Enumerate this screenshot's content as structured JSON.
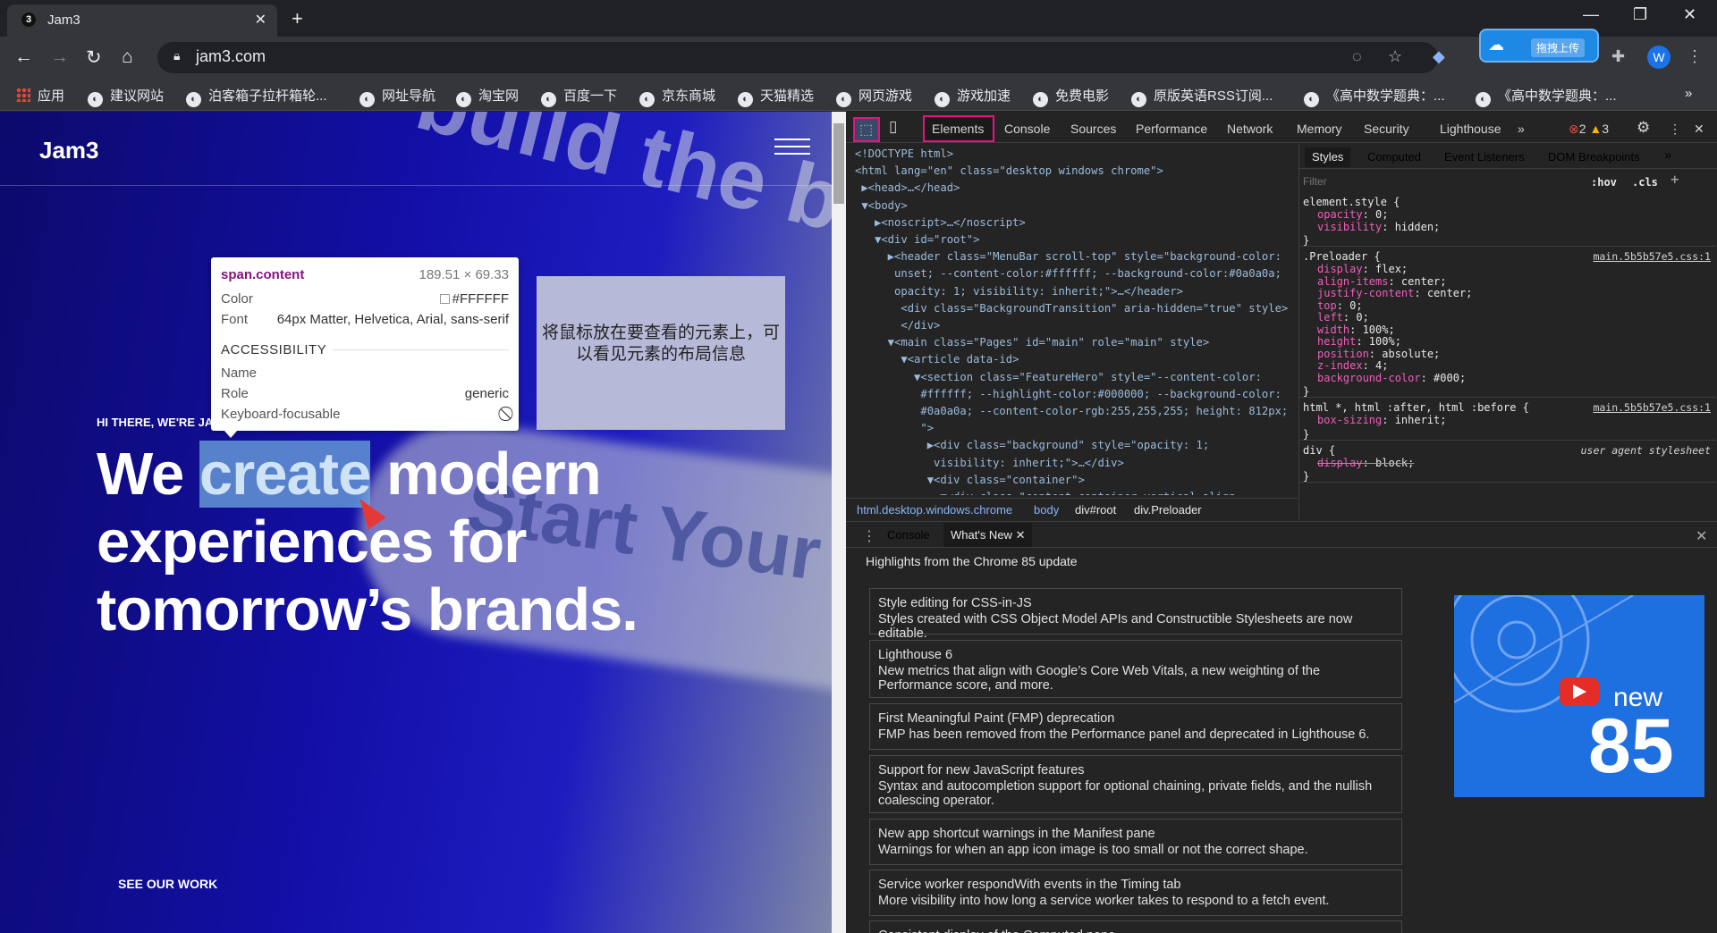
{
  "browser": {
    "tab_title": "Jam3",
    "tab_favicon": "3",
    "new_tab": "+",
    "url": "jam3.com",
    "upload_label": "拖拽上传",
    "avatar": "W",
    "window_controls": [
      "—",
      "❐",
      "✕"
    ],
    "bookmarks": [
      "应用",
      "建议网站",
      "泊客箱子拉杆箱轮...",
      "网址导航",
      "淘宝网",
      "百度一下",
      "京东商城",
      "天猫精选",
      "网页游戏",
      "游戏加速",
      "免费电影",
      "原版英语RSS订阅...",
      "《高中数学题典：...",
      "《高中数学题典：..."
    ],
    "bookmarks_more": "»"
  },
  "page": {
    "logo": "Jam3",
    "eyebrow": "HI THERE, WE'RE JA",
    "headline_pre": "We ",
    "headline_hl": "create",
    "headline_post": " modern experiences for tomorrow’s brands.",
    "see_work": "SEE OUR WORK",
    "bg_word_1": "build the bra",
    "bg_word_2": "Start Your Tra"
  },
  "tooltip": {
    "element": "span.content",
    "size": "189.51 × 69.33",
    "color_label": "Color",
    "color_value": "#FFFFFF",
    "font_label": "Font",
    "font_value": "64px Matter, Helvetica, Arial, sans-serif",
    "section": "ACCESSIBILITY",
    "name_label": "Name",
    "role_label": "Role",
    "role_value": "generic",
    "kb_label": "Keyboard-focusable"
  },
  "note": "将鼠标放在要查看的元素上，可以看见元素的布局信息",
  "devtools": {
    "tabs": [
      "Elements",
      "Console",
      "Sources",
      "Performance",
      "Network",
      "Memory",
      "Security",
      "Lighthouse"
    ],
    "more": "»",
    "errors": "2",
    "warnings": "3",
    "code": [
      "<!DOCTYPE html>",
      "<html lang=\"en\" class=\"desktop windows chrome\">",
      " ▶<head>…</head>",
      " ▼<body>",
      "   ▶<noscript>…</noscript>",
      "   ▼<div id=\"root\">",
      "     ▶<header class=\"MenuBar scroll-top\" style=\"background-color:",
      "      unset; --content-color:#ffffff; --background-color:#0a0a0a;",
      "      opacity: 1; visibility: inherit;\">…</header>",
      "       <div class=\"BackgroundTransition\" aria-hidden=\"true\" style>",
      "       </div>",
      "     ▼<main class=\"Pages\" id=\"main\" role=\"main\" style>",
      "       ▼<article data-id>",
      "         ▼<section class=\"FeatureHero\" style=\"--content-color:",
      "          #ffffff; --highlight-color:#000000; --background-color:",
      "          #0a0a0a; --content-color-rgb:255,255,255; height: 812px;",
      "          \">",
      "           ▶<div class=\"background\" style=\"opacity: 1;",
      "            visibility: inherit;\">…</div>",
      "           ▼<div class=\"container\">",
      "             ▼<div class=\"content-container vertical-align-"
    ],
    "breadcrumbs": [
      "html.desktop.windows.chrome",
      "body",
      "div#root",
      "div.Preloader"
    ],
    "styles_tabs": [
      "Styles",
      "Computed",
      "Event Listeners",
      "DOM Breakpoints"
    ],
    "filter_placeholder": "Filter",
    "hov": ":hov",
    "cls": ".cls",
    "styles": [
      {
        "sel": "element.style {",
        "src": "",
        "props": [
          [
            "opacity",
            "0"
          ],
          [
            "visibility",
            "hidden"
          ]
        ]
      },
      {
        "sel": ".Preloader {",
        "src": "main.5b5b57e5.css:1",
        "props": [
          [
            "display",
            "flex"
          ],
          [
            "align-items",
            "center"
          ],
          [
            "justify-content",
            "center"
          ],
          [
            "top",
            "0"
          ],
          [
            "left",
            "0"
          ],
          [
            "width",
            "100%"
          ],
          [
            "height",
            "100%"
          ],
          [
            "position",
            "absolute"
          ],
          [
            "z-index",
            "4"
          ],
          [
            "background-color",
            "#000"
          ]
        ]
      },
      {
        "sel": "html *, html :after, html :before {",
        "src": "main.5b5b57e5.css:1",
        "props": [
          [
            "box-sizing",
            "inherit"
          ]
        ]
      },
      {
        "sel": "div {",
        "src": "user agent stylesheet",
        "props": [
          [
            "display",
            "block"
          ]
        ]
      }
    ],
    "drawer_tabs": [
      "Console",
      "What's New"
    ],
    "whats_new_heading": "Highlights from the Chrome 85 update",
    "cards": [
      {
        "title": "Style editing for CSS-in-JS",
        "desc": "Styles created with CSS Object Model APIs and Constructible Stylesheets are now editable."
      },
      {
        "title": "Lighthouse 6",
        "desc": "New metrics that align with Google’s Core Web Vitals, a new weighting of the Performance score, and more."
      },
      {
        "title": "First Meaningful Paint (FMP) deprecation",
        "desc": "FMP has been removed from the Performance panel and deprecated in Lighthouse 6."
      },
      {
        "title": "Support for new JavaScript features",
        "desc": "Syntax and autocompletion support for optional chaining, private fields, and the nullish coalescing operator."
      },
      {
        "title": "New app shortcut warnings in the Manifest pane",
        "desc": "Warnings for when an app icon image is too small or not the correct shape."
      },
      {
        "title": "Service worker respondWith events in the Timing tab",
        "desc": "More visibility into how long a service worker takes to respond to a fetch event."
      },
      {
        "title": "Consistent display of the Computed pane",
        "desc": ""
      }
    ],
    "promo_new": "new",
    "promo_num": "85"
  },
  "colors": {
    "highlight": "#6fa8dc",
    "inspect_outline": "#e0157f",
    "tooltip_tag": "#881280",
    "css_prop": "#ef5fbb"
  }
}
